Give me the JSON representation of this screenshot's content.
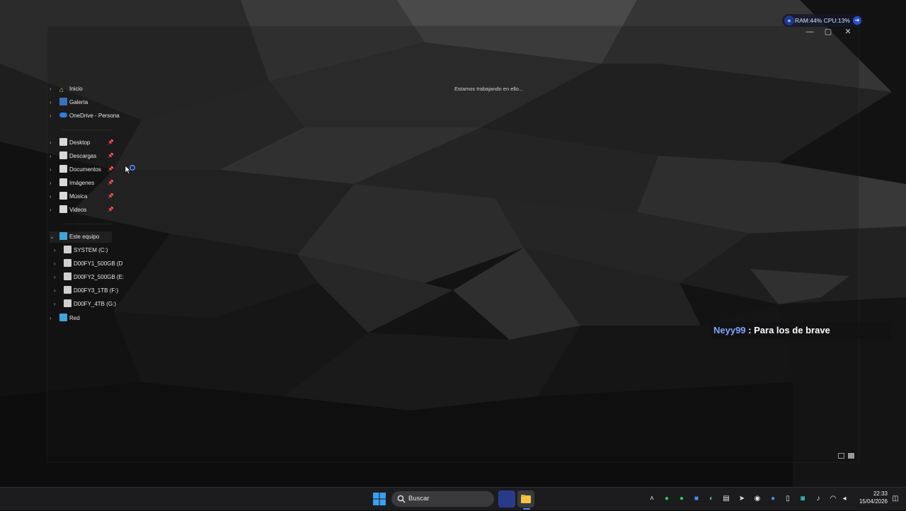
{
  "perf_widget": {
    "text": "RAM:44%  CPU:13%"
  },
  "window_controls": {
    "minimize": "—",
    "maximize": "▢",
    "close": "✕"
  },
  "sidebar": {
    "quick": [
      {
        "label": "Inicio",
        "icon": "home-icon"
      },
      {
        "label": "Galería",
        "icon": "gallery-icon"
      },
      {
        "label": "OneDrive - Persona",
        "icon": "onedrive-cloud-icon"
      }
    ],
    "pinned": [
      {
        "label": "Desktop",
        "icon": "folder-icon"
      },
      {
        "label": "Descargas",
        "icon": "folder-icon"
      },
      {
        "label": "Documentos",
        "icon": "folder-icon"
      },
      {
        "label": "Imágenes",
        "icon": "folder-icon"
      },
      {
        "label": "Música",
        "icon": "folder-icon"
      },
      {
        "label": "Videos",
        "icon": "folder-icon"
      }
    ],
    "this_pc": {
      "label": "Este equipo",
      "icon": "computer-icon"
    },
    "drives": [
      {
        "label": "SYSTEM (C:)"
      },
      {
        "label": "D00FY1_500GB (D"
      },
      {
        "label": "D00FY2_500GB (E:"
      },
      {
        "label": "D00FY3_1TB (F:)"
      },
      {
        "label": "D00FY_4TB (G:)"
      }
    ],
    "network": {
      "label": "Red",
      "icon": "network-icon"
    }
  },
  "main": {
    "status": "Estamos trabajando en ello..."
  },
  "chat_overlay": {
    "user": "Neyy99",
    "separator": " : ",
    "message": "Para los de brave"
  },
  "taskbar": {
    "search_label": "Buscar",
    "tray_icons": [
      "chevron-up-icon",
      "whatsapp-icon",
      "spotify-icon",
      "app-icon",
      "edge-icon",
      "keyboard-icon",
      "telegram-icon",
      "discord-icon",
      "steam-icon",
      "phone-icon",
      "app-icon",
      "microphone-icon",
      "wifi-icon",
      "volume-icon"
    ],
    "time": "22:33",
    "date": "15/04/2026"
  },
  "colors": {
    "accent": "#4a8dff",
    "chat_user": "#7fa6ff",
    "taskbar_bg": "#1c1c1e"
  }
}
